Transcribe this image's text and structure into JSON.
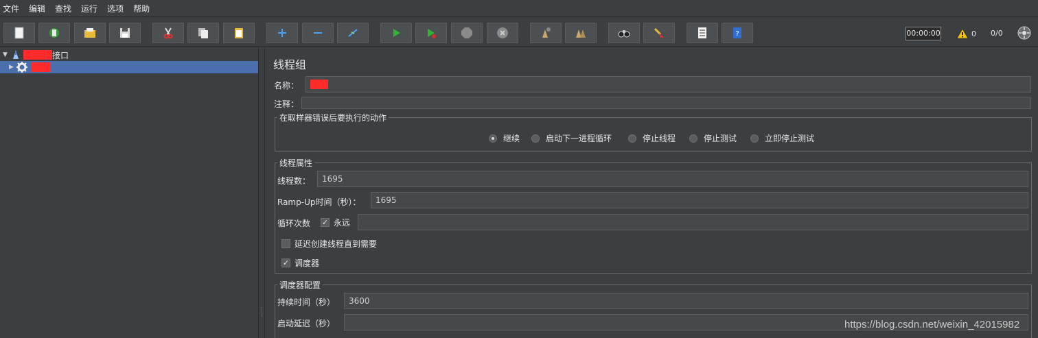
{
  "menu": [
    "文件",
    "编辑",
    "查找",
    "运行",
    "选项",
    "帮助"
  ],
  "toolbar": {
    "buttons": [
      "new-icon",
      "templates-icon",
      "open-icon",
      "save-icon",
      "cut-icon",
      "copy-icon",
      "paste-icon",
      "expand-icon",
      "collapse-icon",
      "toggle-icon",
      "start-icon",
      "start-no-pause-icon",
      "stop-icon",
      "shutdown-icon",
      "clear-icon",
      "clear-all-icon",
      "search-icon",
      "reset-search-icon",
      "function-helper-icon",
      "help-icon"
    ],
    "timer": "00:00:00",
    "warning_count": "0",
    "threads_ratio": "0/0"
  },
  "tree": {
    "root_suffix": "接口",
    "child_label": ""
  },
  "panel": {
    "title": "线程组",
    "name_label": "名称：",
    "comment_label": "注释：",
    "error_action": {
      "legend": "在取样器错误后要执行的动作",
      "options": [
        "继续",
        "启动下一进程循环",
        "停止线程",
        "停止测试",
        "立即停止测试"
      ],
      "selected": "继续"
    },
    "thread_props": {
      "legend": "线程属性",
      "threads_label": "线程数：",
      "threads_value": "1695",
      "rampup_label": "Ramp-Up时间（秒）：",
      "rampup_value": "1695",
      "loop_label": "循环次数",
      "forever_label": "永远",
      "forever_checked": true,
      "delay_label": "延迟创建线程直到需要",
      "delay_checked": false,
      "scheduler_label": "调度器",
      "scheduler_checked": true
    },
    "scheduler": {
      "legend": "调度器配置",
      "duration_label": "持续时间（秒）",
      "duration_value": "3600",
      "startup_label": "启动延迟（秒）",
      "startup_value": ""
    }
  },
  "colors": {
    "background": "#3c3f41",
    "selection": "#4b6eaf",
    "redaction": "#ff2b2b"
  },
  "watermark": "https://blog.csdn.net/weixin_42015982"
}
